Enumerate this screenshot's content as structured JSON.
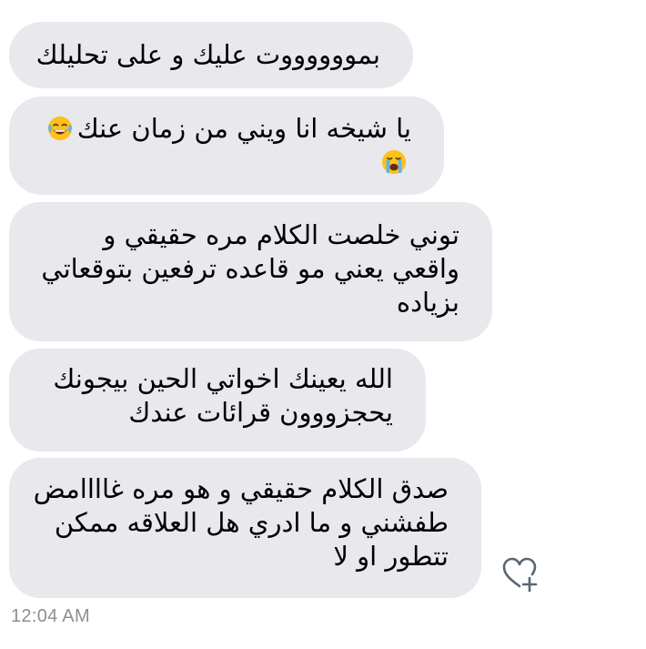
{
  "messages": [
    {
      "lines": [
        "بمووووووت عليك و على تحليلك"
      ]
    },
    {
      "lines": [
        "يا شيخه انا ويني من زمان عنك",
        ""
      ],
      "emojis": [
        "face-with-tears-of-joy-icon",
        "loudly-crying-face-icon"
      ]
    },
    {
      "lines": [
        "توني خلصت الكلام مره حقيقي و",
        "واقعي يعني مو قاعده ترفعين بتوقعاتي",
        "بزياده"
      ]
    },
    {
      "lines": [
        "الله يعينك اخواتي الحين بيجونك",
        "يحجزووون قرائات عندك"
      ]
    },
    {
      "lines": [
        "صدق الكلام حقيقي و هو مره غاااامض",
        "طفشني و ما ادري هل العلاقه ممكن",
        "تتطور او لا"
      ]
    }
  ],
  "timestamp": "12:04 AM",
  "icons": {
    "react": "heart-plus-icon"
  },
  "colors": {
    "bubble": "#e8e8ed",
    "text": "#000000",
    "timestamp": "#8e8e93",
    "icon": "#5a6573"
  }
}
